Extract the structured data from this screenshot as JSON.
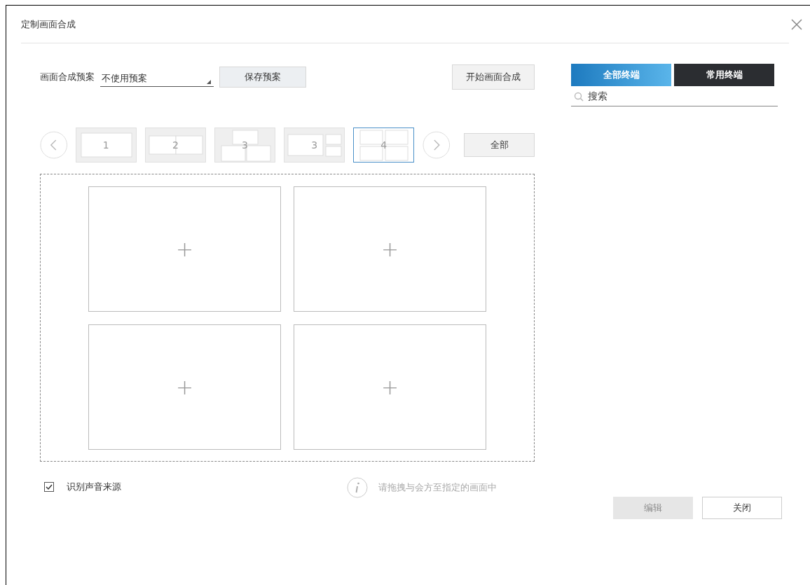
{
  "window": {
    "title": "定制画面合成"
  },
  "preset": {
    "label": "画面合成预案",
    "value": "不使用预案"
  },
  "save_button": "保存预案",
  "start_button": "开始画面合成",
  "tabs": [
    {
      "label": "全部终端",
      "selected": true
    },
    {
      "label": "常用终端",
      "selected": false
    }
  ],
  "search": {
    "placeholder": "搜索"
  },
  "layouts": [
    {
      "label": "1",
      "kind": "single",
      "selected": false
    },
    {
      "label": "2",
      "kind": "pair",
      "selected": false
    },
    {
      "label": "3",
      "kind": "pyramid",
      "selected": false
    },
    {
      "label": "3",
      "kind": "side",
      "selected": false
    },
    {
      "label": "4",
      "kind": "quad",
      "selected": true
    }
  ],
  "all_button": "全部",
  "cells": [
    {
      "kind": "add",
      "label": "+"
    },
    {
      "kind": "add",
      "label": "+"
    },
    {
      "kind": "add",
      "label": "+"
    },
    {
      "kind": "add",
      "label": "+"
    }
  ],
  "sound_source": {
    "label": "识别声音来源",
    "checked": true
  },
  "hint": "请拖拽与会方至指定的画面中",
  "edit_button": {
    "label": "编辑",
    "disabled": true
  },
  "close_button": {
    "label": "关闭",
    "disabled": false
  }
}
